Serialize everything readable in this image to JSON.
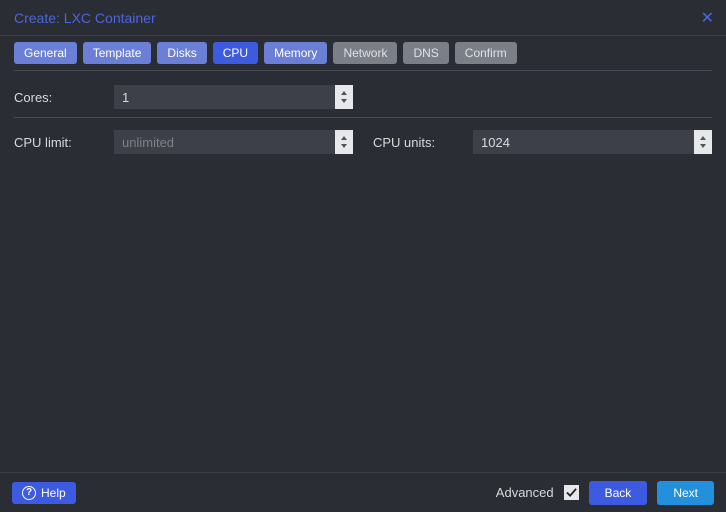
{
  "title": "Create: LXC Container",
  "tabs": [
    {
      "label": "General",
      "state": "normal"
    },
    {
      "label": "Template",
      "state": "normal"
    },
    {
      "label": "Disks",
      "state": "normal"
    },
    {
      "label": "CPU",
      "state": "active"
    },
    {
      "label": "Memory",
      "state": "normal"
    },
    {
      "label": "Network",
      "state": "disabled"
    },
    {
      "label": "DNS",
      "state": "disabled"
    },
    {
      "label": "Confirm",
      "state": "disabled"
    }
  ],
  "fields": {
    "cores": {
      "label": "Cores:",
      "value": "1",
      "placeholder": ""
    },
    "cpu_limit": {
      "label": "CPU limit:",
      "value": "",
      "placeholder": "unlimited"
    },
    "cpu_units": {
      "label": "CPU units:",
      "value": "1024",
      "placeholder": ""
    }
  },
  "footer": {
    "help": "Help",
    "advanced_label": "Advanced",
    "advanced_checked": true,
    "back": "Back",
    "next": "Next"
  }
}
